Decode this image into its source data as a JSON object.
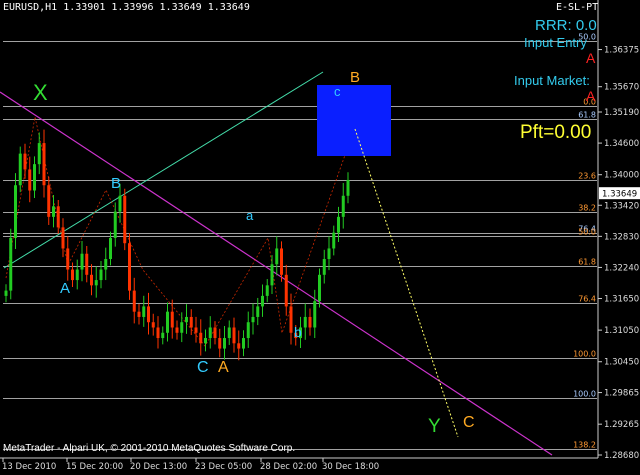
{
  "header": {
    "symbol_line": "EURUSD,H1  1.33901  1.33996  1.33649  1.33649",
    "indicator_name": "E-SL-PT"
  },
  "panel": {
    "rrr": "RRR: 0.0",
    "input_entry": "Input Entry",
    "entry_value": "A",
    "input_market": "Input Market:",
    "market_value": "A",
    "pft": "Pft=0.00"
  },
  "footer": {
    "copyright": "MetaTrader - Alpari UK, © 2001-2010 MetaQuotes Software Corp."
  },
  "colors": {
    "background": "#000000",
    "bull_candle": "#22cc22",
    "bear_candle": "#ff3300",
    "fib_line": "#ffffff",
    "fib_label": "#ff9933",
    "fib_label_blue": "#aaccff",
    "trendline_magenta": "#cc33cc",
    "trendline_green": "#44ddaa",
    "box": "#0a1fff",
    "panel_cyan": "#33ccee",
    "panel_red": "#ff2222",
    "pft_yellow": "#ffff33",
    "wave_green": "#33dd33",
    "wave_cyan": "#33ccff",
    "wave_orange": "#ffaa22",
    "axis": "#cccccc"
  },
  "chart_data": {
    "type": "candlestick",
    "ylim": [
      1.2868,
      1.3705
    ],
    "y_ticks": [
      "1.36375",
      "1.35670",
      "1.35190",
      "1.34600",
      "1.34000",
      "1.33420",
      "1.32830",
      "1.32240",
      "1.31650",
      "1.31050",
      "1.30450",
      "1.29865",
      "1.29265",
      "1.28680"
    ],
    "current_price": "1.33649",
    "x_ticks": [
      "13 Dec 2010",
      "15 Dec 20:00",
      "20 Dec 13:00",
      "23 Dec 05:00",
      "28 Dec 02:00",
      "30 Dec 18:00"
    ],
    "bars": 110,
    "close_path": [
      1.318,
      1.328,
      1.338,
      1.344,
      1.341,
      1.337,
      1.342,
      1.346,
      1.338,
      1.332,
      1.334,
      1.33,
      1.326,
      1.322,
      1.32,
      1.322,
      1.325,
      1.321,
      1.319,
      1.32,
      1.322,
      1.324,
      1.328,
      1.333,
      1.336,
      1.327,
      1.318,
      1.314,
      1.313,
      1.315,
      1.312,
      1.311,
      1.309,
      1.31,
      1.314,
      1.311,
      1.31,
      1.312,
      1.313,
      1.311,
      1.31,
      1.308,
      1.309,
      1.311,
      1.309,
      1.307,
      1.309,
      1.311,
      1.308,
      1.307,
      1.309,
      1.312,
      1.313,
      1.315,
      1.317,
      1.319,
      1.323,
      1.326,
      1.321,
      1.315,
      1.31,
      1.309,
      1.311,
      1.313,
      1.311,
      1.316,
      1.321,
      1.324,
      1.326,
      1.329,
      1.332,
      1.336,
      1.339
    ],
    "fib_levels": [
      {
        "label": "50.0",
        "price": 1.3653,
        "color": "blue"
      },
      {
        "label": "0.0",
        "price": 1.353,
        "color": "orange"
      },
      {
        "label": "61.8",
        "price": 1.3505,
        "color": "blue"
      },
      {
        "label": "23.6",
        "price": 1.339,
        "color": "orange"
      },
      {
        "label": "38.2",
        "price": 1.333,
        "color": "orange"
      },
      {
        "label": "76.4",
        "price": 1.329,
        "color": "blue"
      },
      {
        "label": "50.0",
        "price": 1.3283,
        "color": "orange"
      },
      {
        "label": "61.8",
        "price": 1.3227,
        "color": "orange"
      },
      {
        "label": "76.4",
        "price": 1.3157,
        "color": "orange"
      },
      {
        "label": "100.0",
        "price": 1.3053,
        "color": "orange"
      },
      {
        "label": "100.0",
        "price": 1.2977,
        "color": "blue"
      },
      {
        "label": "138.2",
        "price": 1.288,
        "color": "orange"
      }
    ],
    "wave_labels": [
      {
        "text": "X",
        "color": "green"
      },
      {
        "text": "B",
        "color": "cyan"
      },
      {
        "text": "A",
        "color": "cyan"
      },
      {
        "text": "a",
        "color": "cyan"
      },
      {
        "text": "C",
        "color": "cyan"
      },
      {
        "text": "A",
        "color": "orange"
      },
      {
        "text": "b",
        "color": "cyan"
      },
      {
        "text": "c",
        "color": "cyan"
      },
      {
        "text": "B",
        "color": "orange"
      },
      {
        "text": "Y",
        "color": "green"
      },
      {
        "text": "C",
        "color": "orange"
      }
    ]
  }
}
